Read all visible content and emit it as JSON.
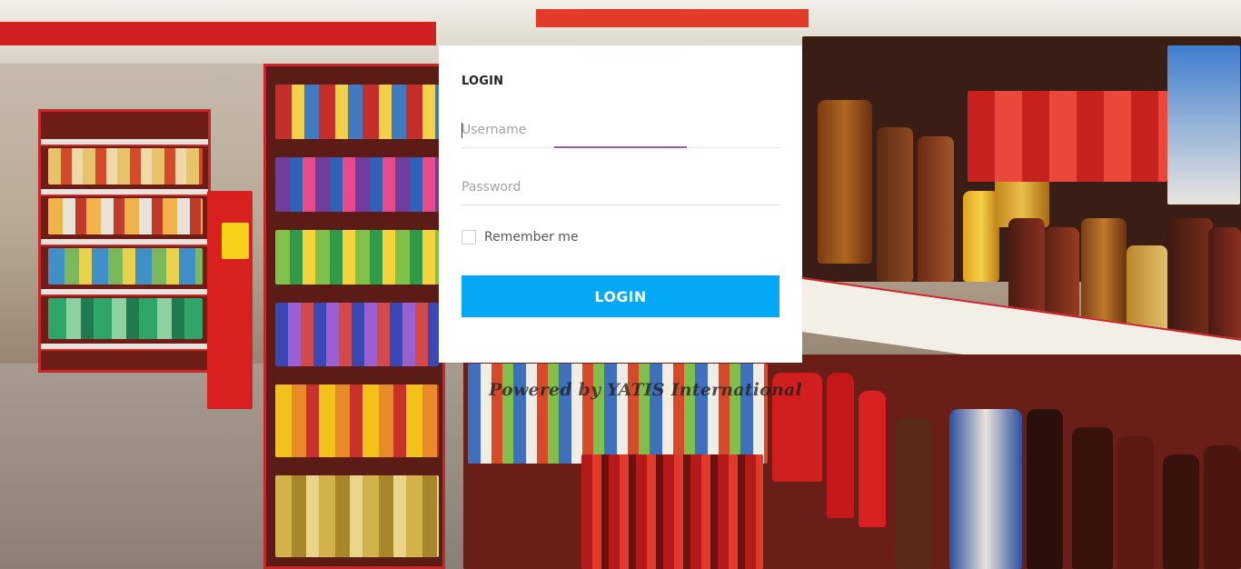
{
  "login": {
    "title": "LOGIN",
    "username_placeholder": "Username",
    "password_placeholder": "Password",
    "remember_label": "Remember me",
    "remember_checked": false,
    "button_label": "LOGIN"
  },
  "footer": {
    "powered_by": "Powered by YATIS International"
  },
  "colors": {
    "button": "#03a9f4",
    "focus_underline": "#9b59b6",
    "card_background": "#ffffff"
  }
}
